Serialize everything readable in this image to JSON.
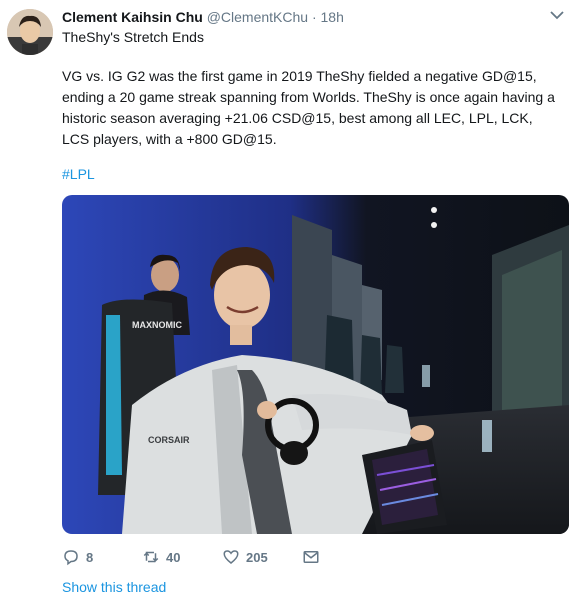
{
  "tweet": {
    "author_name": "Clement Kaihsin Chu",
    "handle": "@ClementKChu",
    "separator": "·",
    "time": "18h",
    "title": "TheShy's Stretch Ends",
    "body": "VG vs. IG G2 was the first game in 2019 TheShy fielded a negative GD@15, ending a 20 game streak spanning from Worlds. TheShy is once again having a historic season averaging +21.06 CSD@15, best among all LEC, LPL, LCK, LCS players, with a +800 GD@15.",
    "hashtag": "#LPL",
    "photo_chair_text": "MAXNOMIC",
    "photo_logo_text": "CORSAIR",
    "replies": "8",
    "retweets": "40",
    "likes": "205",
    "show_thread": "Show this thread"
  },
  "colors": {
    "link": "#1b95e0",
    "muted": "#657786",
    "text": "#14171a"
  },
  "icons": [
    "avatar",
    "chevron-down-icon",
    "reply-icon",
    "retweet-icon",
    "like-icon",
    "message-icon"
  ]
}
